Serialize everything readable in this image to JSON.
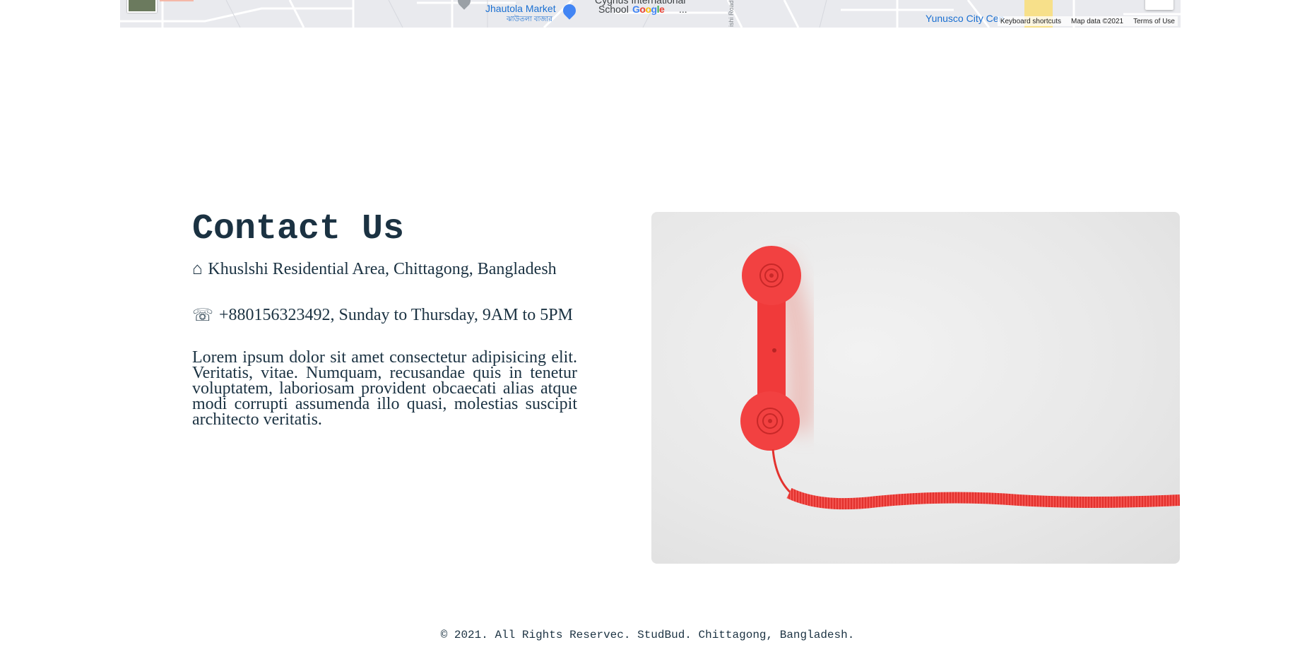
{
  "map": {
    "places": {
      "market": "Jhautola Market",
      "market_bn": "ঝাউতলা বাজার",
      "school_line1": "Cygnus International",
      "school_line2": "School",
      "school_tail": "...",
      "center": "Yunusco City Cen",
      "road": "ishi Road"
    },
    "logo": "Google",
    "attribution": {
      "shortcuts": "Keyboard shortcuts",
      "map_data": "Map data ©2021",
      "terms": "Terms of Use"
    }
  },
  "contact": {
    "title": "Contact Us",
    "address_icon": "house-icon",
    "address": "Khuslshi Residential Area, Chittagong, Bangladesh",
    "phone_icon": "telephone-icon",
    "phone": "+880156323492, Sunday to Thursday, 9AM to 5PM",
    "description": "Lorem ipsum dolor sit amet consectetur adipisicing elit. Veritatis, vitae. Numquam, recusandae quis in tenetur voluptatem, laboriosam provident obcaecati alias atque modi corrupti assumenda illo quasi, molestias suscipit architecto veritatis."
  },
  "photo": {
    "subject": "red telephone handset",
    "colors": {
      "phone": "#f03a3a",
      "background": "#ececec"
    }
  },
  "footer": {
    "text": "© 2021. All Rights Reservec. StudBud. Chittagong, Bangladesh."
  },
  "colors": {
    "text": "#1b3242"
  }
}
